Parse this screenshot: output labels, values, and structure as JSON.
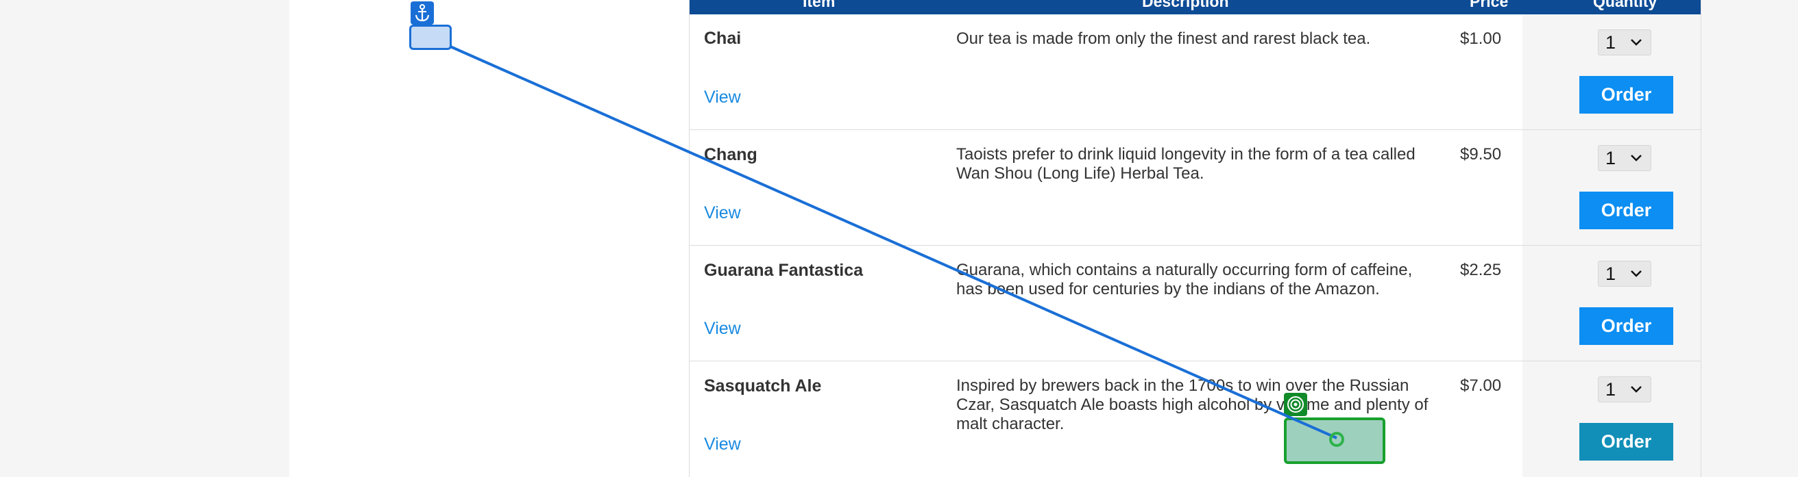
{
  "table": {
    "headers": {
      "item": "Item",
      "description": "Description",
      "price": "Price",
      "quantity": "Quantity"
    },
    "rows": [
      {
        "name": "Chai",
        "description": "Our tea is made from only the finest and rarest black tea.",
        "price": "$1.00",
        "quantity": "1",
        "view_label": "View",
        "order_label": "Order"
      },
      {
        "name": "Chang",
        "description": "Taoists prefer to drink liquid longevity in the form of a tea called Wan Shou (Long Life) Herbal Tea.",
        "price": "$9.50",
        "quantity": "1",
        "view_label": "View",
        "order_label": "Order"
      },
      {
        "name": "Guarana Fantastica",
        "description": "Guarana, which contains a naturally occurring form of caffeine, has been used for centuries by the indians of the Amazon.",
        "price": "$2.25",
        "quantity": "1",
        "view_label": "View",
        "order_label": "Order"
      },
      {
        "name": "Sasquatch Ale",
        "description": "Inspired by brewers back in the 1700s to win over the Russian Czar, Sasquatch Ale boasts high alcohol by volume and plenty of malt character.",
        "price": "$7.00",
        "quantity": "1",
        "view_label": "View",
        "order_label": "Order"
      }
    ]
  },
  "overlay": {
    "anchor_icon": "anchor-icon",
    "target_icon": "target-icon",
    "drag_color": "#1a6fd6",
    "target_color": "#18a02e"
  }
}
